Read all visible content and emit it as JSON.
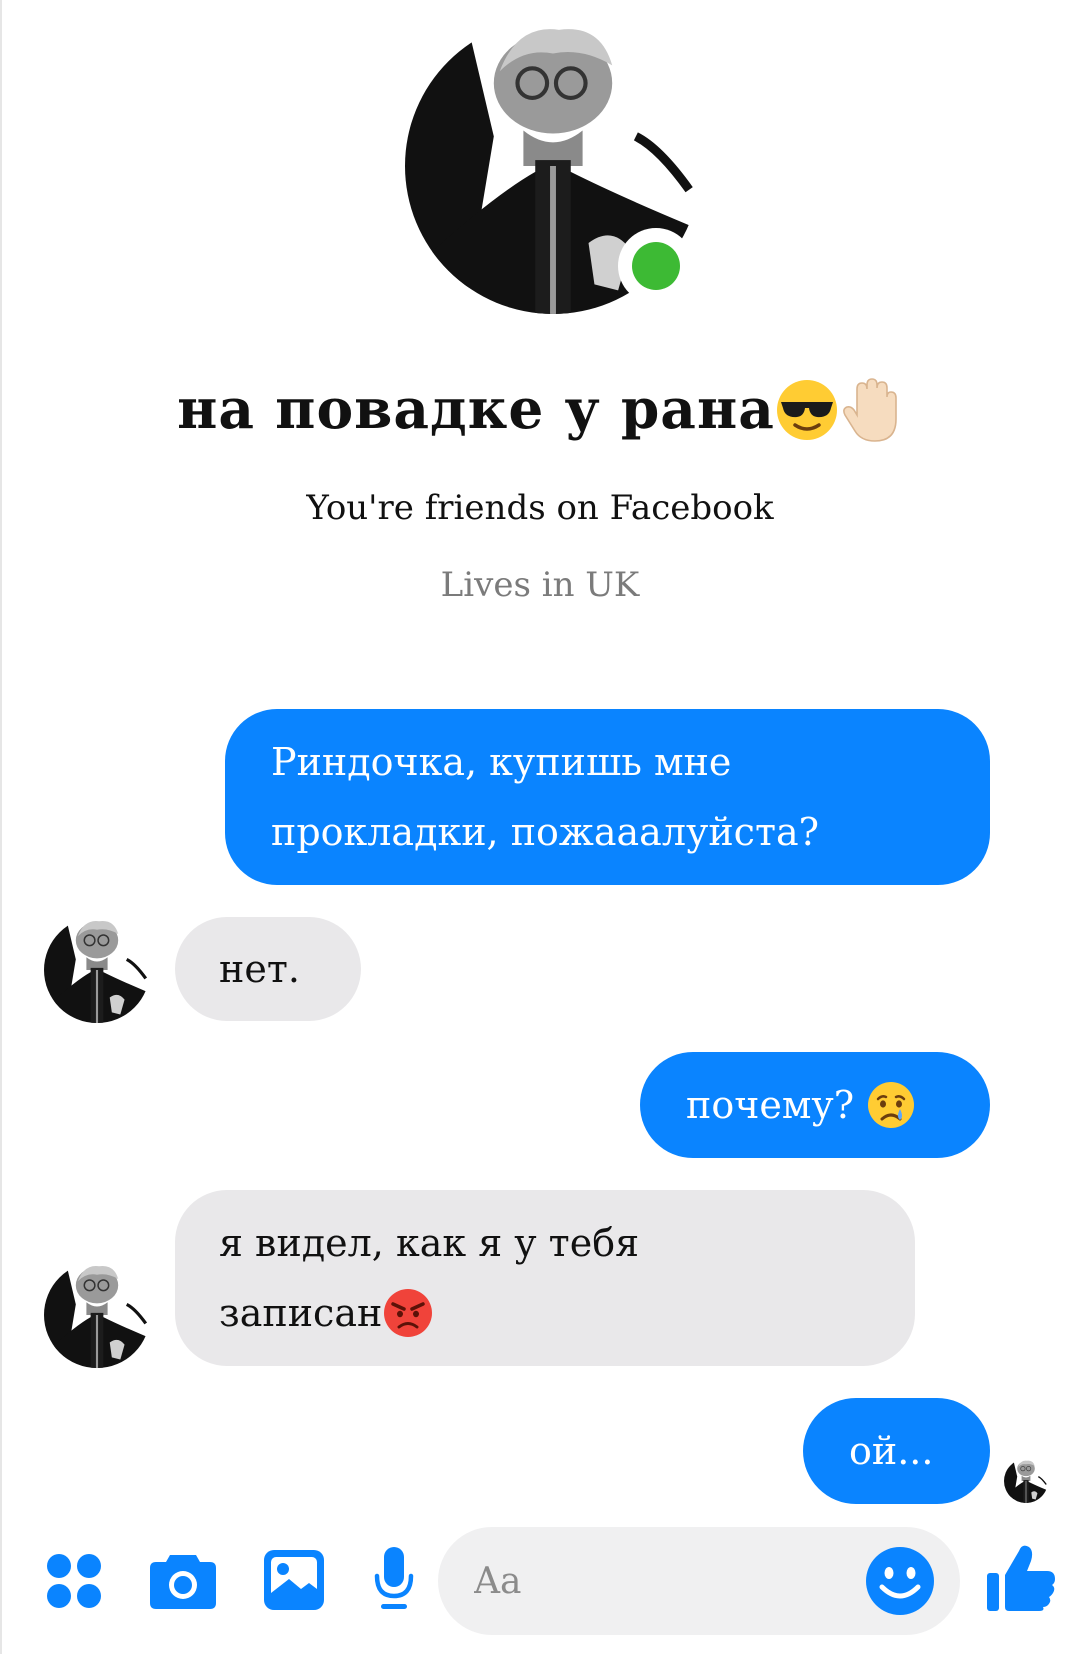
{
  "header": {
    "name": "на повадке у рана",
    "name_emojis": [
      "smiling-face-with-sunglasses",
      "raised-hand-light-skin-tone"
    ],
    "online": true,
    "friends_text": "You're friends on Facebook",
    "location_text": "Lives in UK"
  },
  "messages": [
    {
      "side": "outgoing",
      "lines": [
        "Риндочка, купишь мне",
        "прокладки, пожааалуйста?"
      ]
    },
    {
      "side": "incoming",
      "lines": [
        "нет."
      ]
    },
    {
      "side": "outgoing",
      "text": "почему?",
      "emoji": "crying-face"
    },
    {
      "side": "incoming",
      "lines": [
        "я видел, как я у тебя",
        "записан"
      ],
      "emoji": "angry-face"
    },
    {
      "side": "outgoing",
      "text": "ой..."
    }
  ],
  "composer": {
    "placeholder": "Aa",
    "icons": [
      "apps-icon",
      "camera-icon",
      "gallery-icon",
      "mic-icon",
      "emoji-icon",
      "thumbs-up-icon"
    ]
  },
  "colors": {
    "outgoing_bubble": "#0a84ff",
    "incoming_bubble": "#e9e8ea",
    "accent": "#0a84ff",
    "online": "#3dba34",
    "secondary_text": "#7b7b7b"
  }
}
